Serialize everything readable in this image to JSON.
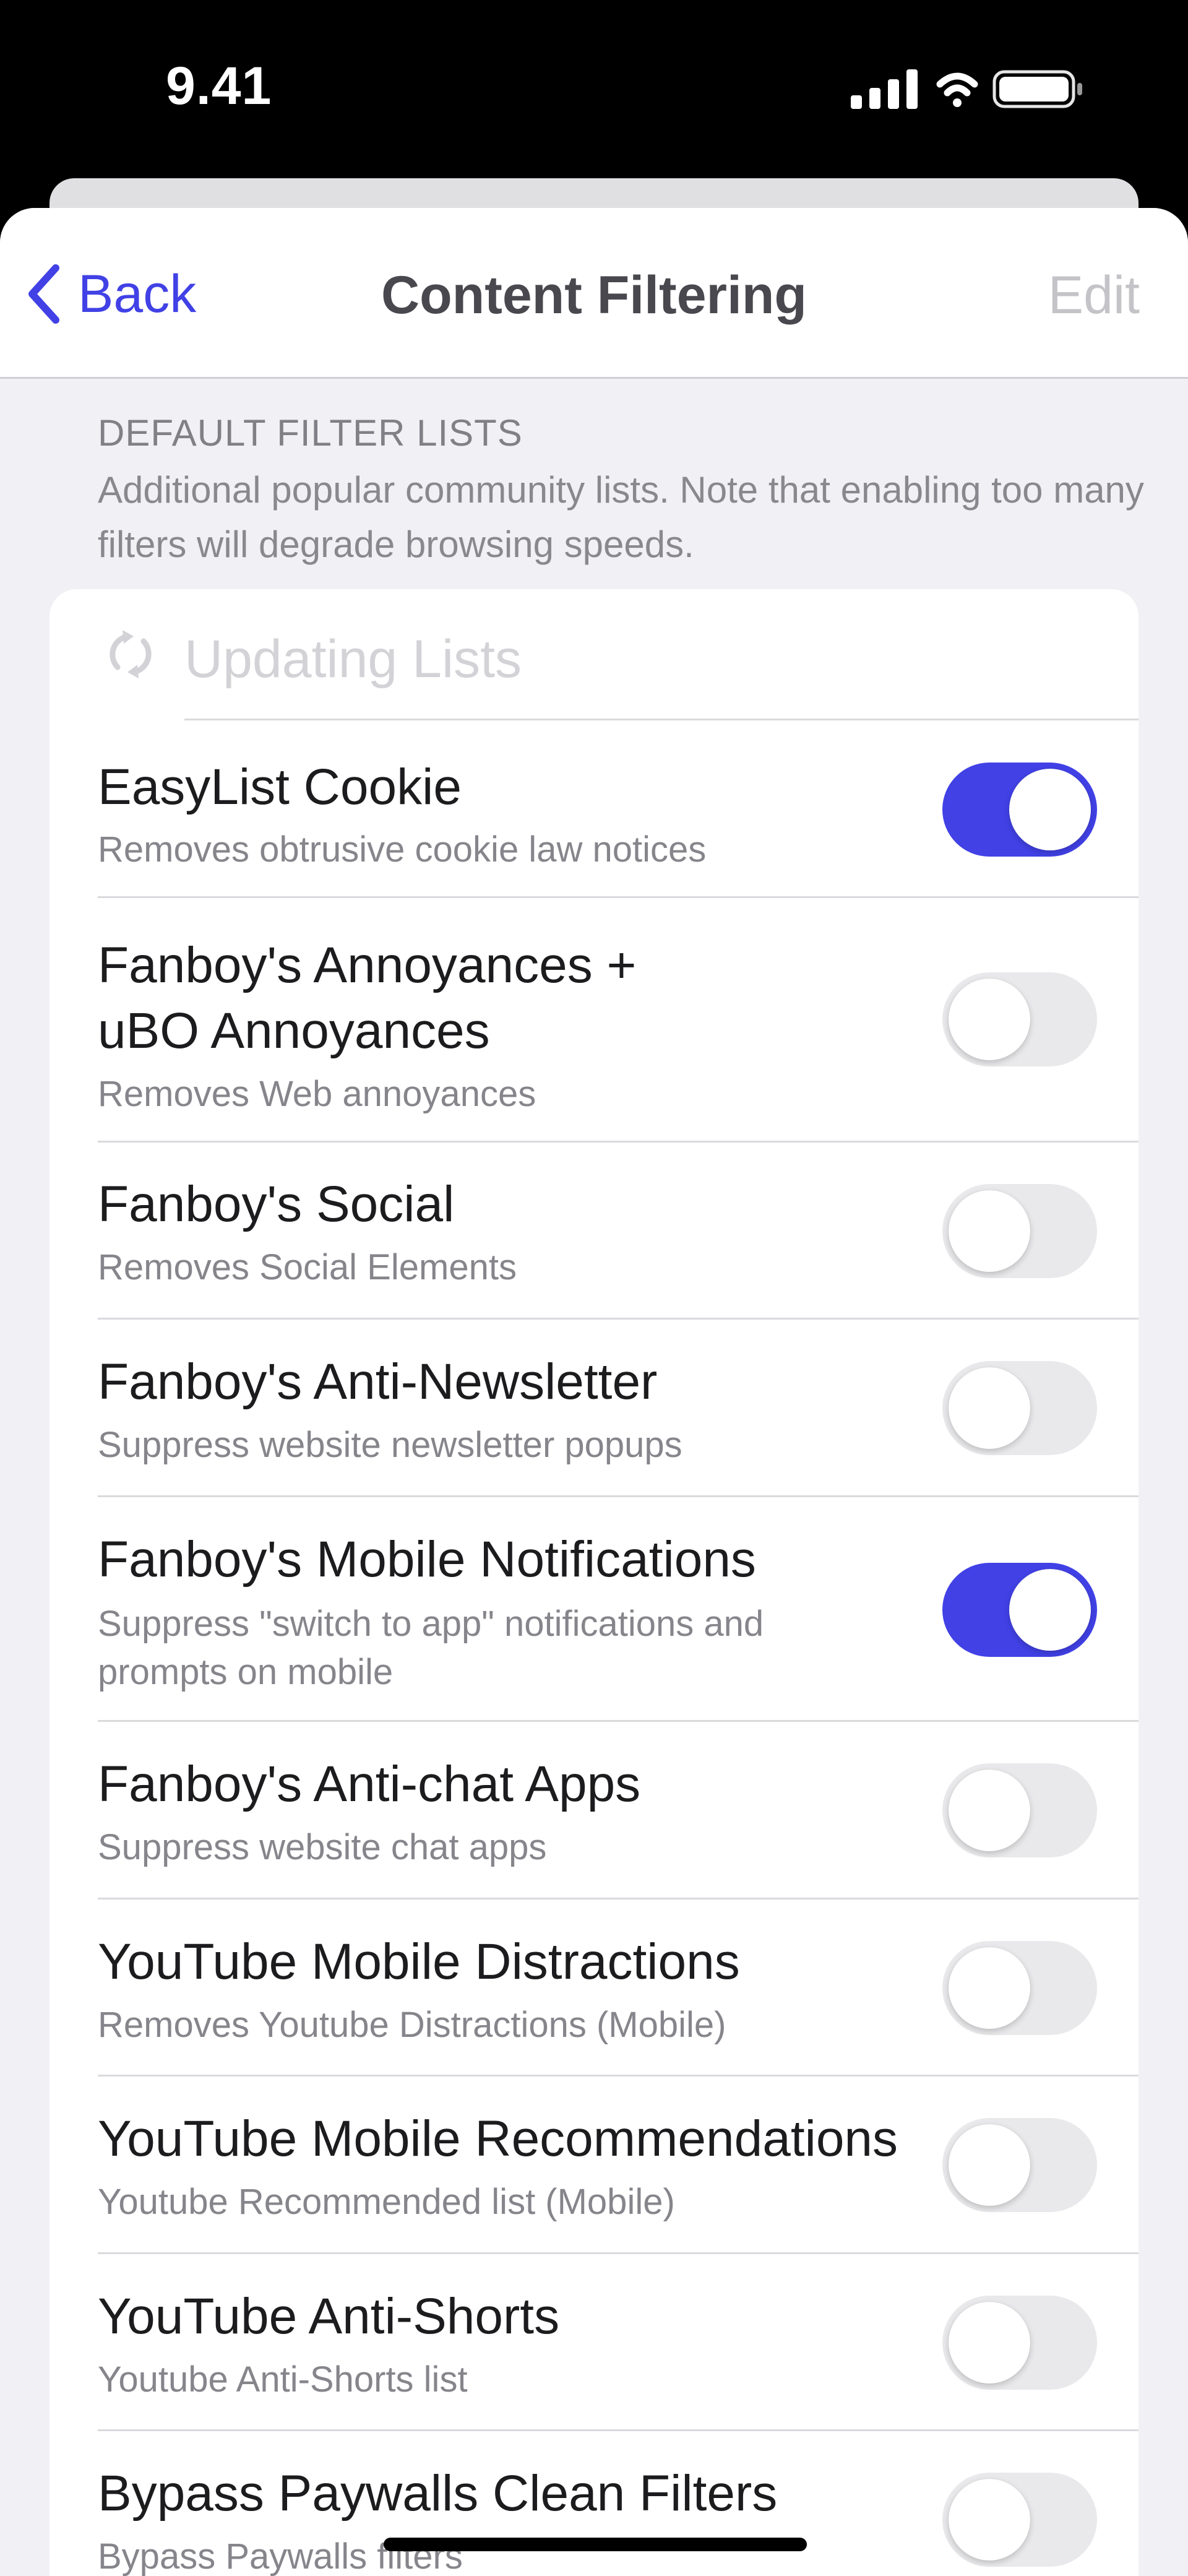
{
  "status_bar": {
    "time": "9.41"
  },
  "nav": {
    "back_label": "Back",
    "title": "Content Filtering",
    "edit_label": "Edit"
  },
  "section": {
    "title": "DEFAULT FILTER LISTS",
    "description": "Additional popular community lists. Note that enabling too many filters will degrade browsing speeds."
  },
  "updating": {
    "label": "Updating Lists"
  },
  "filters": [
    {
      "title": "EasyList Cookie",
      "subtitle": "Removes obtrusive cookie law notices",
      "enabled": true
    },
    {
      "title": "Fanboy's Annoyances + uBO Annoyances",
      "subtitle": "Removes Web annoyances",
      "enabled": false
    },
    {
      "title": "Fanboy's Social",
      "subtitle": "Removes Social Elements",
      "enabled": false
    },
    {
      "title": "Fanboy's Anti-Newsletter",
      "subtitle": "Suppress website newsletter popups",
      "enabled": false
    },
    {
      "title": "Fanboy's Mobile Notifications",
      "subtitle": "Suppress \"switch to app\" notifications and prompts on mobile",
      "enabled": true
    },
    {
      "title": "Fanboy's Anti-chat Apps",
      "subtitle": "Suppress website chat apps",
      "enabled": false
    },
    {
      "title": "YouTube Mobile Distractions",
      "subtitle": "Removes Youtube Distractions (Mobile)",
      "enabled": false
    },
    {
      "title": "YouTube Mobile Recommendations",
      "subtitle": "Youtube Recommended list (Mobile)",
      "enabled": false
    },
    {
      "title": "YouTube Anti-Shorts",
      "subtitle": "Youtube Anti-Shorts list",
      "enabled": false
    },
    {
      "title": "Bypass Paywalls Clean Filters",
      "subtitle": "Bypass Paywalls filters",
      "enabled": false
    }
  ],
  "colors": {
    "accent": "#4141e6",
    "toggle_off": "#e9e9eb",
    "background": "#f1f1f5"
  }
}
